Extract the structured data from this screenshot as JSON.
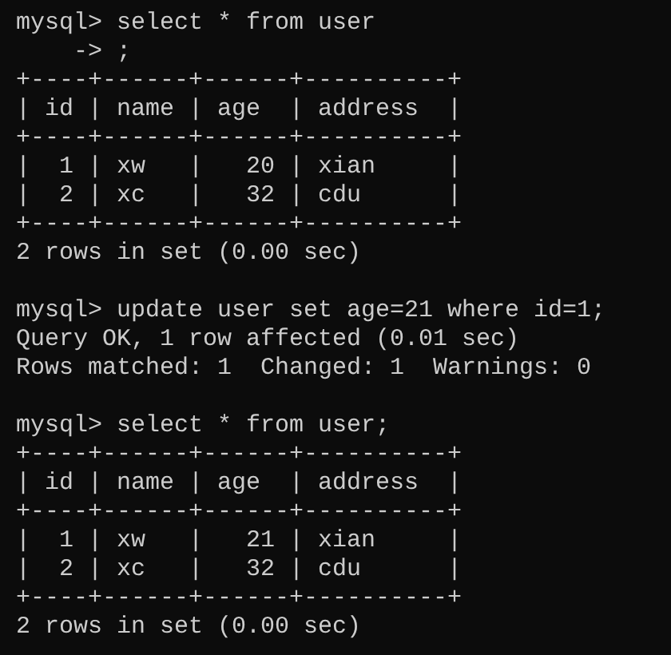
{
  "terminal": {
    "blocks": [
      [
        "mysql> select * from user",
        "    -> ;",
        "+----+------+------+----------+",
        "| id | name | age  | address  |",
        "+----+------+------+----------+",
        "|  1 | xw   |   20 | xian     |",
        "|  2 | xc   |   32 | cdu      |",
        "+----+------+------+----------+",
        "2 rows in set (0.00 sec)"
      ],
      [
        "mysql> update user set age=21 where id=1;",
        "Query OK, 1 row affected (0.01 sec)",
        "Rows matched: 1  Changed: 1  Warnings: 0"
      ],
      [
        "mysql> select * from user;",
        "+----+------+------+----------+",
        "| id | name | age  | address  |",
        "+----+------+------+----------+",
        "|  1 | xw   |   21 | xian     |",
        "|  2 | xc   |   32 | cdu      |",
        "+----+------+------+----------+",
        "2 rows in set (0.00 sec)"
      ]
    ]
  }
}
